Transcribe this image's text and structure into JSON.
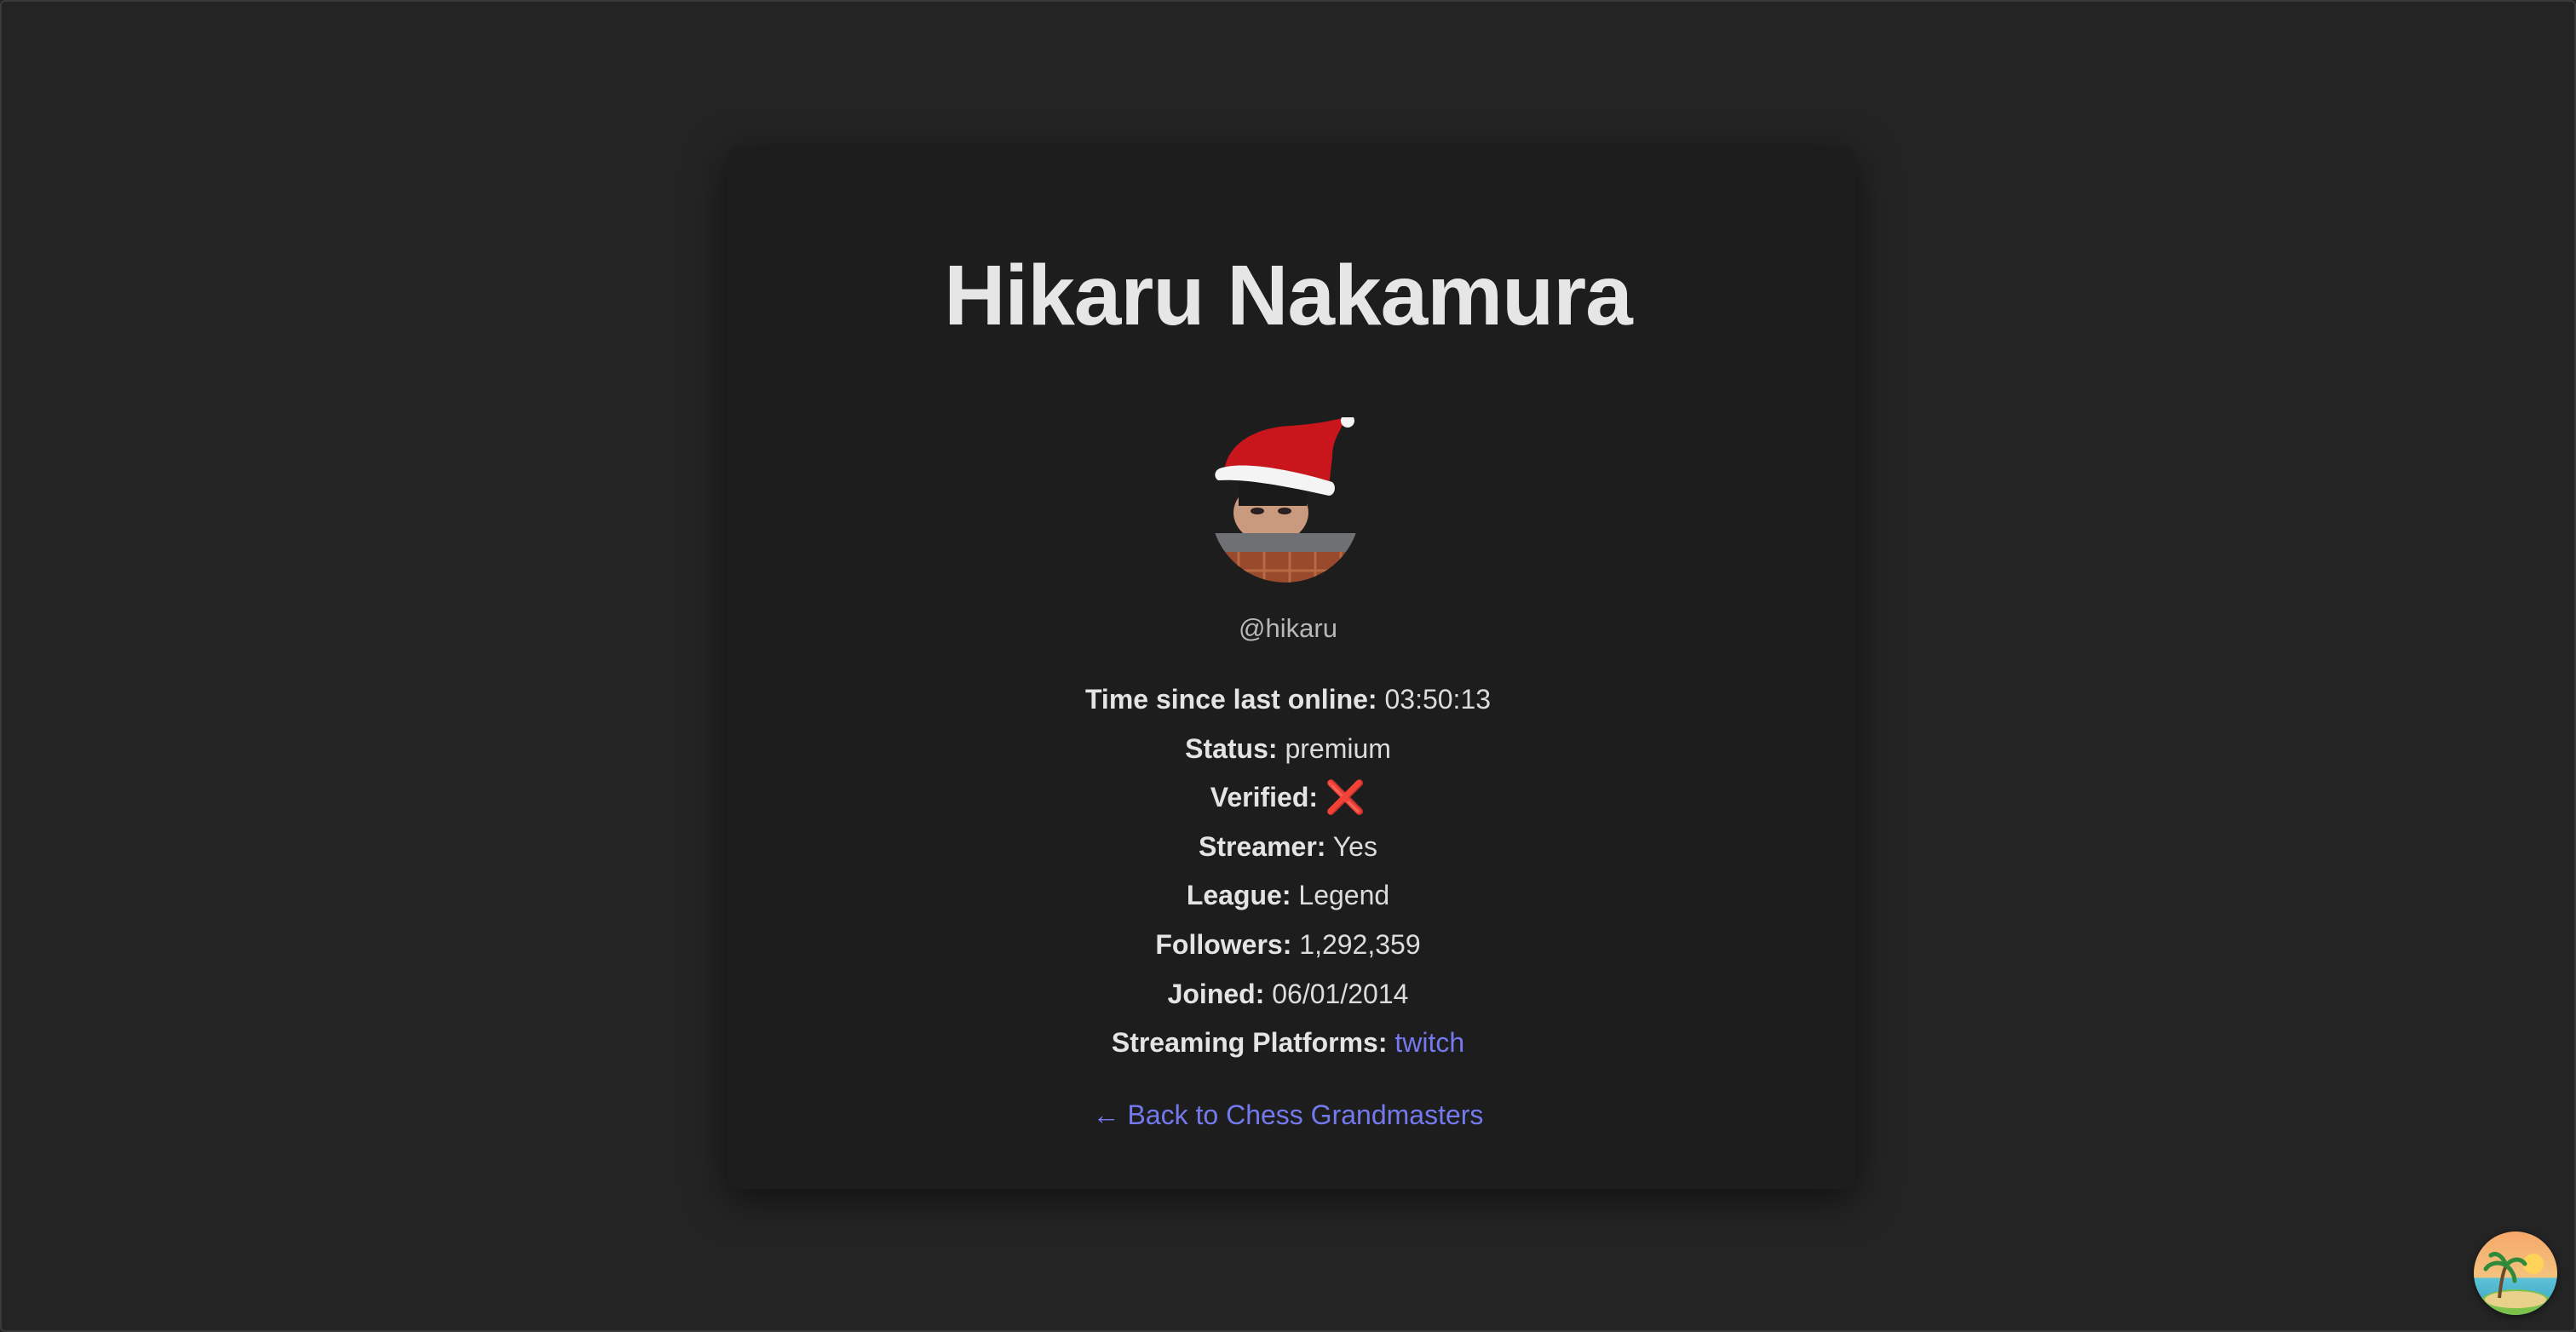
{
  "profile": {
    "name": "Hikaru Nakamura",
    "handle": "@hikaru",
    "avatar_alt": "avatar-with-santa-hat"
  },
  "details": [
    {
      "label": "Time since last online:",
      "value": "03:50:13"
    },
    {
      "label": "Status:",
      "value": "premium"
    },
    {
      "label": "Verified:",
      "value": "❌"
    },
    {
      "label": "Streamer:",
      "value": "Yes"
    },
    {
      "label": "League:",
      "value": "Legend"
    },
    {
      "label": "Followers:",
      "value": "1,292,359"
    },
    {
      "label": "Joined:",
      "value": "06/01/2014"
    },
    {
      "label": "Streaming Platforms:",
      "value": "twitch"
    }
  ],
  "back_link": "← Back to Chess Grandmasters",
  "colors": {
    "background": "#242424",
    "card": "#1d1d1d",
    "link": "#7479ee",
    "cross": "#d4302a"
  },
  "icons": {
    "corner": "beach-island-icon",
    "verified": "cross-mark-icon"
  }
}
